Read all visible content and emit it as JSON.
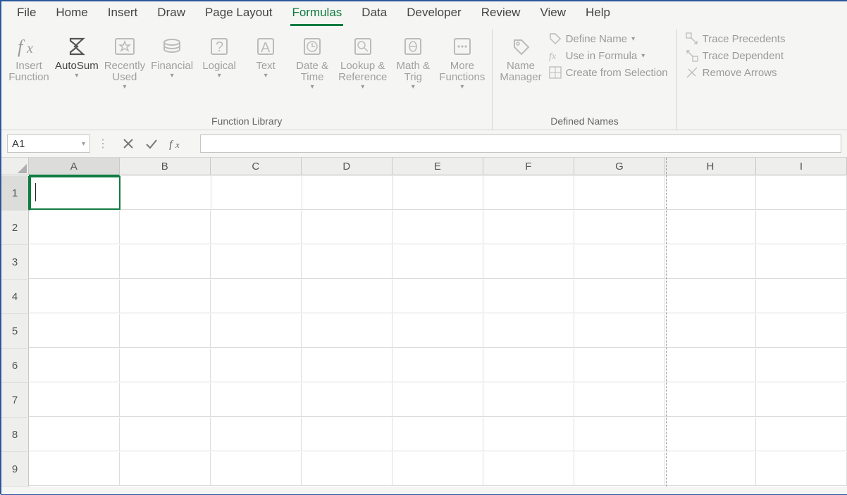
{
  "ribbon_tabs": [
    {
      "label": "File"
    },
    {
      "label": "Home"
    },
    {
      "label": "Insert"
    },
    {
      "label": "Draw"
    },
    {
      "label": "Page Layout"
    },
    {
      "label": "Formulas",
      "active": true
    },
    {
      "label": "Data"
    },
    {
      "label": "Developer"
    },
    {
      "label": "Review"
    },
    {
      "label": "View"
    },
    {
      "label": "Help"
    }
  ],
  "ribbon_groups": {
    "function_library": {
      "label": "Function Library",
      "items": {
        "insert_function": "Insert\nFunction",
        "autosum": "AutoSum",
        "recently_used": "Recently\nUsed",
        "financial": "Financial",
        "logical": "Logical",
        "text": "Text",
        "date_time": "Date &\nTime",
        "lookup_reference": "Lookup &\nReference",
        "math_trig": "Math &\nTrig",
        "more_functions": "More\nFunctions"
      }
    },
    "defined_names": {
      "label": "Defined Names",
      "items": {
        "name_manager": "Name\nManager",
        "define_name": "Define Name",
        "use_in_formula": "Use in Formula",
        "create_from_selection": "Create from Selection"
      }
    },
    "formula_auditing": {
      "items": {
        "trace_precedents": "Trace Precedents",
        "trace_dependent": "Trace Dependent",
        "remove_arrows": "Remove Arrows"
      }
    }
  },
  "formula_bar": {
    "name_box": "A1",
    "formula": ""
  },
  "grid": {
    "columns": [
      "A",
      "B",
      "C",
      "D",
      "E",
      "F",
      "G",
      "H",
      "I"
    ],
    "rows": [
      "1",
      "2",
      "3",
      "4",
      "5",
      "6",
      "7",
      "8",
      "9"
    ],
    "selected_cell": "A1"
  }
}
